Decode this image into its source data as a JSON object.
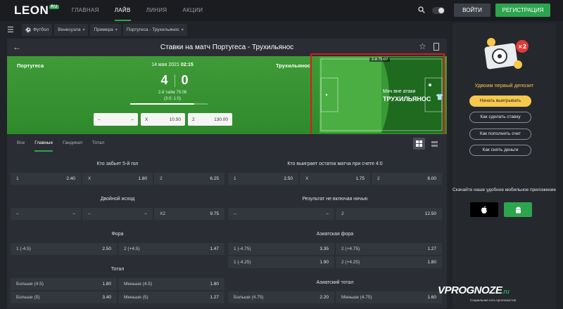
{
  "header": {
    "logo": "LEON",
    "logo_badge": "RU",
    "nav": [
      "ГЛАВНАЯ",
      "ЛАЙВ",
      "ЛИНИЯ",
      "АКЦИИ"
    ],
    "login": "ВОЙТИ",
    "register": "РЕГИСТРАЦИЯ"
  },
  "breadcrumbs": [
    "Футбол",
    "Венесуэла",
    "Примера",
    "Португеса - Трухильянос"
  ],
  "match": {
    "title": "Ставки на матч Португеса - Трухильянос",
    "home": "Португеса",
    "away": "Трухильянос",
    "date": "14 мая 2021",
    "time": "02:15",
    "score_home": "4",
    "score_away": "0",
    "period": "2-й тайм 75:06",
    "period_score": "(3:0; 1:0)",
    "progress": 0.83,
    "odds": [
      {
        "label": "–",
        "value": "–"
      },
      {
        "label": "X",
        "value": "10.50"
      },
      {
        "label": "2",
        "value": "130.00"
      }
    ]
  },
  "pitch": {
    "time_label": "2-й 75:07",
    "event": "Мяч вне атаки",
    "team": "ТРУХИЛЬЯНОС"
  },
  "tabs": [
    "Все",
    "Главные",
    "Гандикап",
    "Тотал"
  ],
  "markets_left": [
    {
      "title": "Кто забьет 5-й гол",
      "rows": [
        [
          [
            "1",
            "2.40"
          ],
          [
            "X",
            "1.80"
          ],
          [
            "2",
            "6.25"
          ]
        ]
      ]
    },
    {
      "title": "Двойной исход",
      "rows": [
        [
          [
            "–",
            "–"
          ],
          [
            "–",
            "–"
          ],
          [
            "X2",
            "9.75"
          ]
        ]
      ]
    },
    {
      "title": "Фора",
      "rows": [
        [
          [
            "1 (-4.5)",
            "2.50"
          ],
          [
            "2 (+4.5)",
            "1.47"
          ]
        ]
      ]
    },
    {
      "title": "Тотал",
      "rows": [
        [
          [
            "Больше (4.5)",
            "1.80"
          ],
          [
            "Меньше (4.5)",
            "1.80"
          ]
        ],
        [
          [
            "Больше (5)",
            "3.40"
          ],
          [
            "Меньше (5)",
            "1.27"
          ]
        ]
      ]
    }
  ],
  "markets_right": [
    {
      "title": "Кто выигрaет остаток матча при счете 4:0",
      "rows": [
        [
          [
            "1",
            "2.50"
          ],
          [
            "X",
            "1.75"
          ],
          [
            "2",
            "8.00"
          ]
        ]
      ]
    },
    {
      "title": "Результат не включая ничью",
      "rows": [
        [
          [
            "–",
            "–"
          ],
          [
            "2",
            "12.50"
          ]
        ]
      ]
    },
    {
      "title": "Азиатская фора",
      "rows": [
        [
          [
            "1 (-4.75)",
            "3.35"
          ],
          [
            "2 (+4.75)",
            "1.27"
          ]
        ],
        [
          [
            "1 (-4.25)",
            "1.90"
          ],
          [
            "2 (+4.25)",
            "1.80"
          ]
        ]
      ]
    },
    {
      "title": "Азиатский тотал",
      "rows": [
        [
          [
            "Больше (4.75)",
            "2.20"
          ],
          [
            "Меньше (4.75)",
            "1.60"
          ]
        ]
      ]
    }
  ],
  "sidebar": {
    "promo_badge": "×2",
    "promo_title": "Удвоим первый депозит",
    "play_button": "Начать выигрывать",
    "links": [
      "Как сделать ставку",
      "Как пополнить счет",
      "Как снять деньги"
    ],
    "app_title": "Скачайте наше удобное мобильное приложение"
  },
  "watermark": {
    "text": "VPROGNOZE",
    "suffix": ".ru",
    "sub": "Социальная сеть прогнозистов"
  },
  "colors": {
    "accent": "#2da44e",
    "promo": "#f6c84c",
    "highlight": "#e01919"
  }
}
